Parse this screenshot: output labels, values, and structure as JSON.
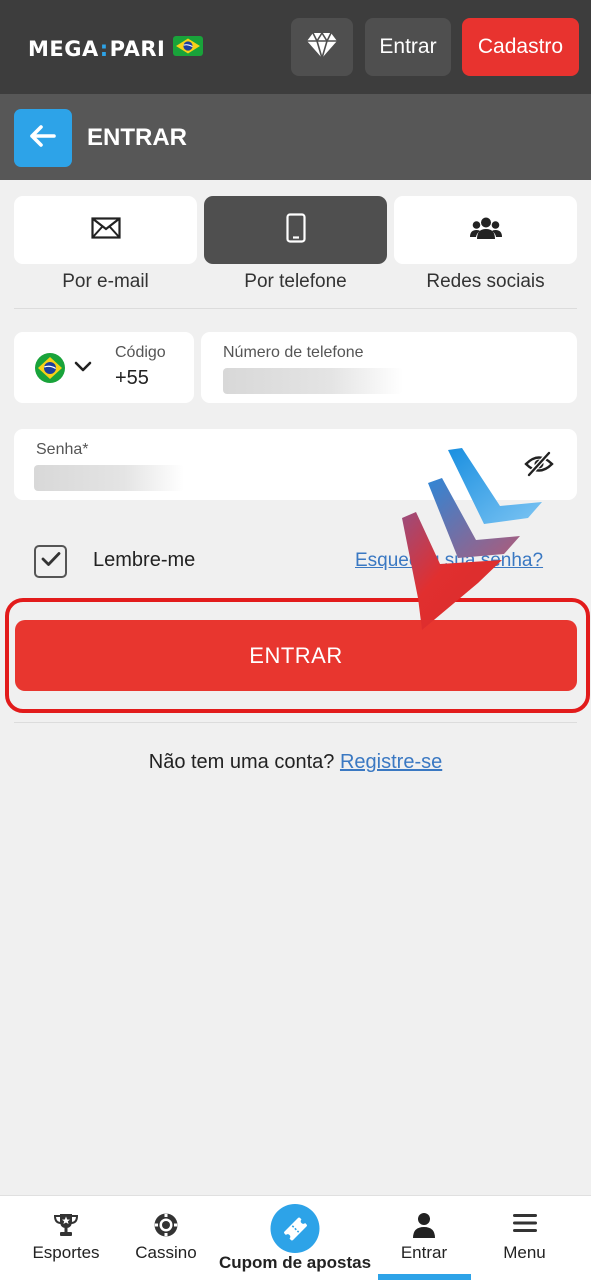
{
  "header": {
    "logo_left": "MEGA",
    "logo_colon": ":",
    "logo_right": "PARI",
    "entrar_label": "Entrar",
    "cadastro_label": "Cadastro"
  },
  "subheader": {
    "title": "ENTRAR"
  },
  "tabs": [
    {
      "label": "Por e-mail",
      "icon": "envelope-icon",
      "active": false
    },
    {
      "label": "Por telefone",
      "icon": "phone-icon",
      "active": true
    },
    {
      "label": "Redes sociais",
      "icon": "users-icon",
      "active": false
    }
  ],
  "form": {
    "code_label": "Código",
    "code_value": "+55",
    "phone_label": "Número de telefone",
    "password_label": "Senha*",
    "remember_label": "Lembre-me",
    "remember_checked": true,
    "forgot_link": "Esqueceu sua senha?",
    "submit_label": "ENTRAR",
    "no_account_text": "Não tem uma conta?",
    "register_link": "Registre-se"
  },
  "bottom_nav": [
    {
      "label": "Esportes",
      "icon": "trophy-icon"
    },
    {
      "label": "Cassino",
      "icon": "casino-chip-icon"
    },
    {
      "label": "Cupom de apostas",
      "icon": "ticket-icon"
    },
    {
      "label": "Entrar",
      "icon": "user-icon",
      "active": true
    },
    {
      "label": "Menu",
      "icon": "hamburger-menu-icon"
    }
  ],
  "colors": {
    "brand_blue": "#2da3e8",
    "brand_red": "#e8362f",
    "topbar": "#3d3d3d",
    "subheader": "#575757"
  }
}
